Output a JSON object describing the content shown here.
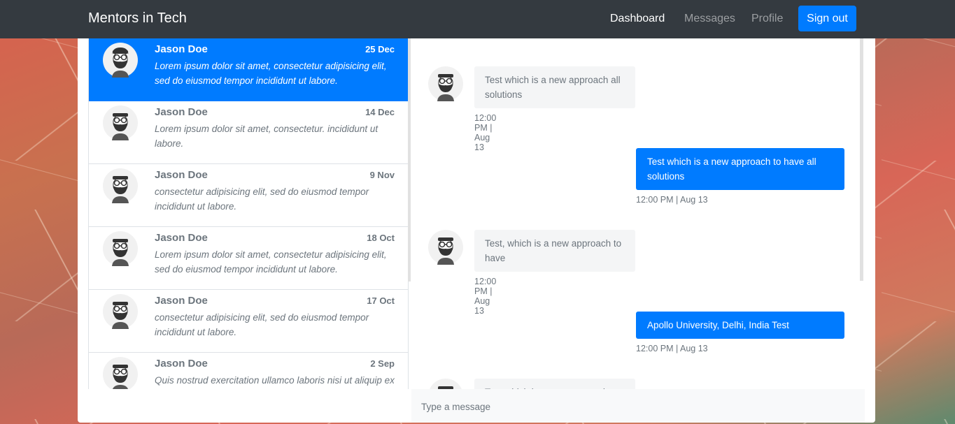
{
  "navbar": {
    "brand": "Mentors in Tech",
    "links": [
      "Dashboard",
      "Messages",
      "Profile"
    ],
    "active": "Dashboard",
    "signout": "Sign out"
  },
  "inbox": [
    {
      "name": "Jason Doe",
      "date": "25 Dec",
      "preview": "Lorem ipsum dolor sit amet, consectetur adipisicing elit, sed do eiusmod tempor incididunt ut labore.",
      "active": true
    },
    {
      "name": "Jason Doe",
      "date": "14 Dec",
      "preview": "Lorem ipsum dolor sit amet, consectetur. incididunt ut labore."
    },
    {
      "name": "Jason Doe",
      "date": "9 Nov",
      "preview": "consectetur adipisicing elit, sed do eiusmod tempor incididunt ut labore."
    },
    {
      "name": "Jason Doe",
      "date": "18 Oct",
      "preview": "Lorem ipsum dolor sit amet, consectetur adipisicing elit, sed do eiusmod tempor incididunt ut labore."
    },
    {
      "name": "Jason Doe",
      "date": "17 Oct",
      "preview": "consectetur adipisicing elit, sed do eiusmod tempor incididunt ut labore."
    },
    {
      "name": "Jason Doe",
      "date": "2 Sep",
      "preview": "Quis nostrud exercitation ullamco laboris nisi ut aliquip ex"
    }
  ],
  "chat": [
    {
      "dir": "in",
      "text": "Test which is a new approach all solutions",
      "time": "12:00 PM | Aug 13"
    },
    {
      "dir": "out",
      "text": "Test which is a new approach to have all solutions",
      "time": "12:00 PM | Aug 13"
    },
    {
      "dir": "in",
      "text": "Test, which is a new approach to have",
      "time": "12:00 PM | Aug 13"
    },
    {
      "dir": "out",
      "text": "Apollo University, Delhi, India Test",
      "time": "12:00 PM | Aug 13"
    },
    {
      "dir": "in",
      "text": "Test which is a new approach",
      "time": ""
    }
  ],
  "composer": {
    "placeholder": "Type a message"
  },
  "colors": {
    "primary": "#007bff",
    "navbar": "#343a40"
  }
}
